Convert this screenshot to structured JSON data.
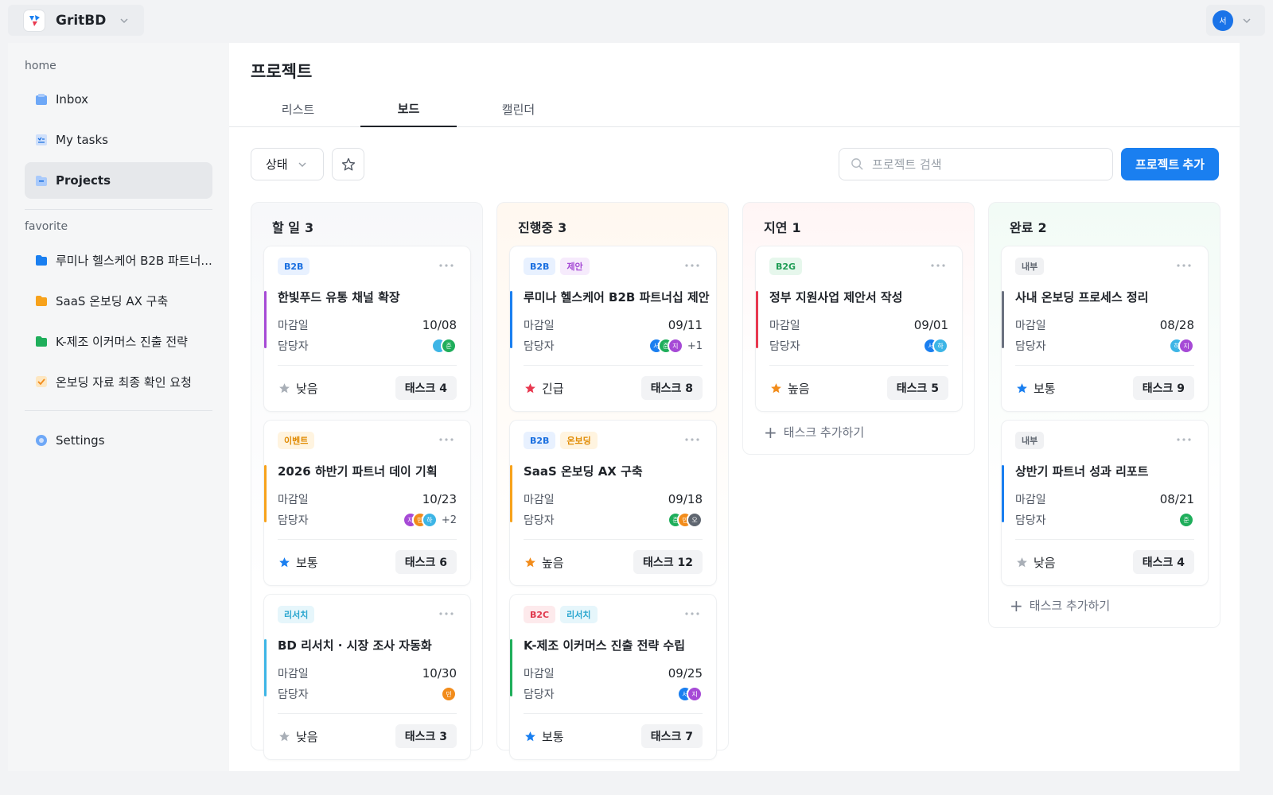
{
  "app": {
    "name": "GritBD",
    "user_initial": "서"
  },
  "sidebar": {
    "sections": {
      "home": "home",
      "favorite": "favorite"
    },
    "home_items": [
      {
        "label": "Inbox",
        "icon": "inbox-icon"
      },
      {
        "label": "My tasks",
        "icon": "tasks-icon"
      },
      {
        "label": "Projects",
        "icon": "folder-icon",
        "active": true
      }
    ],
    "favorite_items": [
      {
        "label": "루미나 헬스케어 B2B 파트너...",
        "icon": "folder-icon",
        "color": "#1a7ff0"
      },
      {
        "label": "SaaS 온보딩 AX 구축",
        "icon": "folder-icon",
        "color": "#f7a21b"
      },
      {
        "label": "K-제조 이커머스 진출 전략",
        "icon": "folder-icon",
        "color": "#1fae5b"
      },
      {
        "label": "온보딩 자료 최종 확인 요청",
        "icon": "checkbox-icon",
        "color": "#f7a21b"
      }
    ],
    "settings": {
      "label": "Settings",
      "icon": "gear-icon"
    }
  },
  "main": {
    "title": "프로젝트",
    "tabs": [
      {
        "label": "리스트"
      },
      {
        "label": "보드",
        "active": true
      },
      {
        "label": "캘린더"
      }
    ],
    "toolbar": {
      "status_label": "상태",
      "search_placeholder": "프로젝트 검색",
      "add_label": "프로젝트 추가"
    }
  },
  "board": {
    "field_labels": {
      "due": "마감일",
      "assignee": "담당자"
    },
    "add_task_label": "태스크 추가하기",
    "columns": [
      {
        "name": "할 일",
        "count": "3",
        "bg": "#f7f8fa",
        "cards": [
          {
            "tags": [
              [
                "B2B",
                "#e8f1ff",
                "#1a6fe0"
              ]
            ],
            "bar": "#a64ad6",
            "title": "한빛푸드 유통 채널 확장",
            "due": "10/08",
            "avatars": [
              [
                "",
                "#3db5e6"
              ],
              [
                "준",
                "#1fae5b"
              ]
            ],
            "extra": "",
            "priority": "낮음",
            "prio_color": "#a9afb7",
            "tasks": "태스크 4"
          },
          {
            "tags": [
              [
                "이벤트",
                "#fff4e0",
                "#e08a00"
              ]
            ],
            "bar": "#f7a21b",
            "title": "2026 하반기 파트너 데이 기획",
            "due": "10/23",
            "avatars": [
              [
                "지",
                "#a64ad6"
              ],
              [
                "민",
                "#f28c1b"
              ],
              [
                "하",
                "#3db5e6"
              ]
            ],
            "extra": "+2",
            "priority": "보통",
            "prio_color": "#1a7ff0",
            "tasks": "태스크 6"
          },
          {
            "tags": [
              [
                "리서치",
                "#e6f6fb",
                "#2aa6cf"
              ]
            ],
            "bar": "#3db5e6",
            "title": "BD 리서치 · 시장 조사 자동화",
            "due": "10/30",
            "avatars": [
              [
                "민",
                "#f28c1b"
              ]
            ],
            "extra": "",
            "priority": "낮음",
            "prio_color": "#a9afb7",
            "tasks": "태스크 3"
          }
        ]
      },
      {
        "name": "진행중",
        "count": "3",
        "bg": "#fff8f0",
        "cards": [
          {
            "tags": [
              [
                "B2B",
                "#e8f1ff",
                "#1a6fe0"
              ],
              [
                "제안",
                "#f6ebfc",
                "#a64ad6"
              ]
            ],
            "bar": "#1a7ff0",
            "title": "루미나 헬스케어 B2B 파트너십 제안",
            "due": "09/11",
            "avatars": [
              [
                "서",
                "#1a7ff0"
              ],
              [
                "준",
                "#1fae5b"
              ],
              [
                "지",
                "#a64ad6"
              ]
            ],
            "extra": "+1",
            "priority": "긴급",
            "prio_color": "#e8384f",
            "tasks": "태스크 8"
          },
          {
            "tags": [
              [
                "B2B",
                "#e8f1ff",
                "#1a6fe0"
              ],
              [
                "온보딩",
                "#fff4e0",
                "#e08a00"
              ]
            ],
            "bar": "#f7a21b",
            "title": "SaaS 온보딩 AX 구축",
            "due": "09/18",
            "avatars": [
              [
                "준",
                "#1fae5b"
              ],
              [
                "민",
                "#f28c1b"
              ],
              [
                "오",
                "#5f6670"
              ]
            ],
            "extra": "",
            "priority": "높음",
            "prio_color": "#f28c1b",
            "tasks": "태스크 12"
          },
          {
            "tags": [
              [
                "B2C",
                "#fdeaec",
                "#e0394d"
              ],
              [
                "리서치",
                "#e6f6fb",
                "#2aa6cf"
              ]
            ],
            "bar": "#1fae5b",
            "title": "K-제조 이커머스 진출 전략 수립",
            "due": "09/25",
            "avatars": [
              [
                "서",
                "#1a7ff0"
              ],
              [
                "지",
                "#a64ad6"
              ]
            ],
            "extra": "",
            "priority": "보통",
            "prio_color": "#1a7ff0",
            "tasks": "태스크 7"
          }
        ]
      },
      {
        "name": "지연",
        "count": "1",
        "bg": "#fff5f5",
        "cards": [
          {
            "tags": [
              [
                "B2G",
                "#e6f7ec",
                "#1f9d55"
              ]
            ],
            "bar": "#e8384f",
            "title": "정부 지원사업 제안서 작성",
            "due": "09/01",
            "avatars": [
              [
                "서",
                "#1a7ff0"
              ],
              [
                "하",
                "#3db5e6"
              ]
            ],
            "extra": "",
            "priority": "높음",
            "prio_color": "#f28c1b",
            "tasks": "태스크 5"
          }
        ]
      },
      {
        "name": "완료",
        "count": "2",
        "bg": "#f2fbf6",
        "cards": [
          {
            "tags": [
              [
                "내부",
                "#f0f1f3",
                "#5f6670"
              ]
            ],
            "bar": "#6b7280",
            "title": "사내 온보딩 프로세스 정리",
            "due": "08/28",
            "avatars": [
              [
                "하",
                "#3db5e6"
              ],
              [
                "지",
                "#a64ad6"
              ]
            ],
            "extra": "",
            "priority": "보통",
            "prio_color": "#1a7ff0",
            "tasks": "태스크 9"
          },
          {
            "tags": [
              [
                "내부",
                "#f0f1f3",
                "#5f6670"
              ]
            ],
            "bar": "#1a7ff0",
            "title": "상반기 파트너 성과 리포트",
            "due": "08/21",
            "avatars": [
              [
                "준",
                "#1fae5b"
              ]
            ],
            "extra": "",
            "priority": "낮음",
            "prio_color": "#a9afb7",
            "tasks": "태스크 4"
          }
        ]
      }
    ]
  }
}
